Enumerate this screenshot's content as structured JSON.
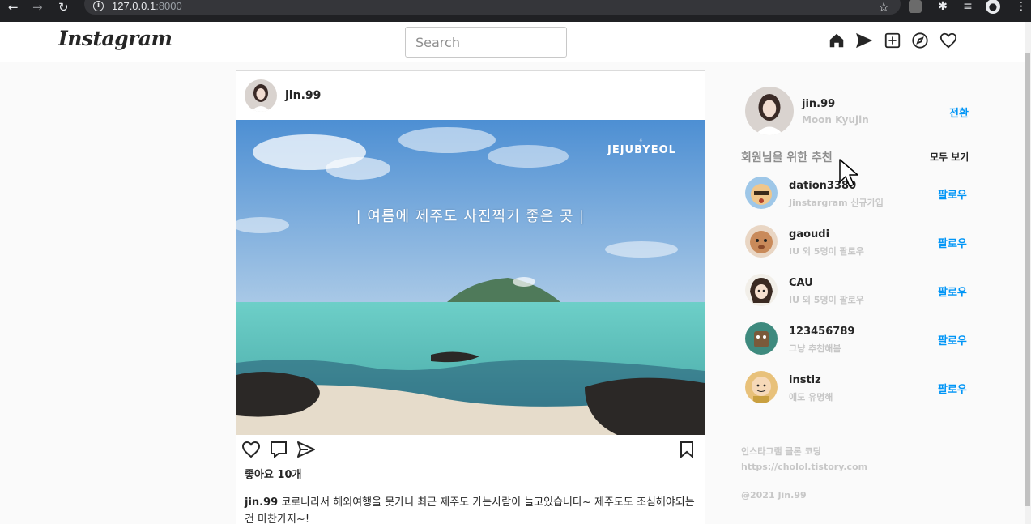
{
  "browser": {
    "url_host": "127.0.0.1",
    "url_port": ":8000"
  },
  "header": {
    "logo": "Instagram",
    "search_placeholder": "Search",
    "icons": [
      "home-icon",
      "direct-icon",
      "new-post-icon",
      "explore-icon",
      "activity-icon"
    ]
  },
  "post": {
    "username": "jin.99",
    "image_caption": "|  여름에 제주도 사진찍기 좋은 곳  |",
    "image_brand": "JEJUBYEOL",
    "likes": "좋아요 10개",
    "caption_user": "jin.99",
    "caption_text": " 코로나라서 해외여행을 못가니 최근 제주도 가는사람이 늘고있습니다~ 제주도도 조심해야되는건 마찬가지~!"
  },
  "profile": {
    "username": "jin.99",
    "name": "Moon Kyujin",
    "switch_label": "전환"
  },
  "recommendations": {
    "title": "회원님을 위한 추천",
    "see_all": "모두 보기",
    "follow_label": "팔로우",
    "items": [
      {
        "username": "dation3380",
        "sub": "Jinstargram 신규가입",
        "color": "#f0c68a"
      },
      {
        "username": "gaoudi",
        "sub": "IU 외 5명이 팔로우",
        "color": "#c98a5a"
      },
      {
        "username": "CAU",
        "sub": "IU 외 5명이 팔로우",
        "color": "#e6e2d8"
      },
      {
        "username": "123456789",
        "sub": "그냥 추천해봄",
        "color": "#3e8a7e"
      },
      {
        "username": "instiz",
        "sub": "얘도 유명해",
        "color": "#e8c17a"
      }
    ]
  },
  "footer": {
    "line1": "인스타그램 클론 코딩",
    "line2": "https://cholol.tistory.com",
    "copyright": "@2021 Jin.99"
  }
}
